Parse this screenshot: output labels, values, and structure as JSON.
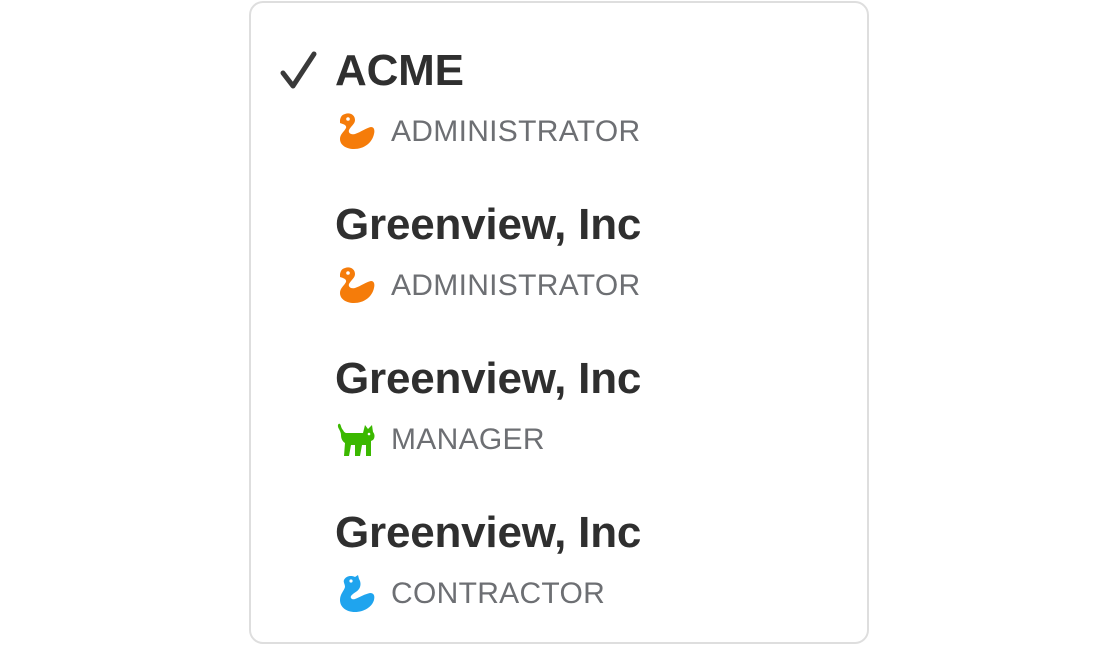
{
  "accounts": [
    {
      "name": "ACME",
      "role": "ADMINISTRATOR",
      "role_icon": "duck-icon",
      "role_color": "#F57C0A",
      "selected": true
    },
    {
      "name": "Greenview, Inc",
      "role": "ADMINISTRATOR",
      "role_icon": "duck-icon",
      "role_color": "#F57C0A",
      "selected": false
    },
    {
      "name": "Greenview, Inc",
      "role": "MANAGER",
      "role_icon": "cat-icon",
      "role_color": "#3BB800",
      "selected": false
    },
    {
      "name": "Greenview, Inc",
      "role": "CONTRACTOR",
      "role_icon": "seal-icon",
      "role_color": "#1FA4EE",
      "selected": false
    }
  ],
  "selected_icon": "checkmark-icon"
}
